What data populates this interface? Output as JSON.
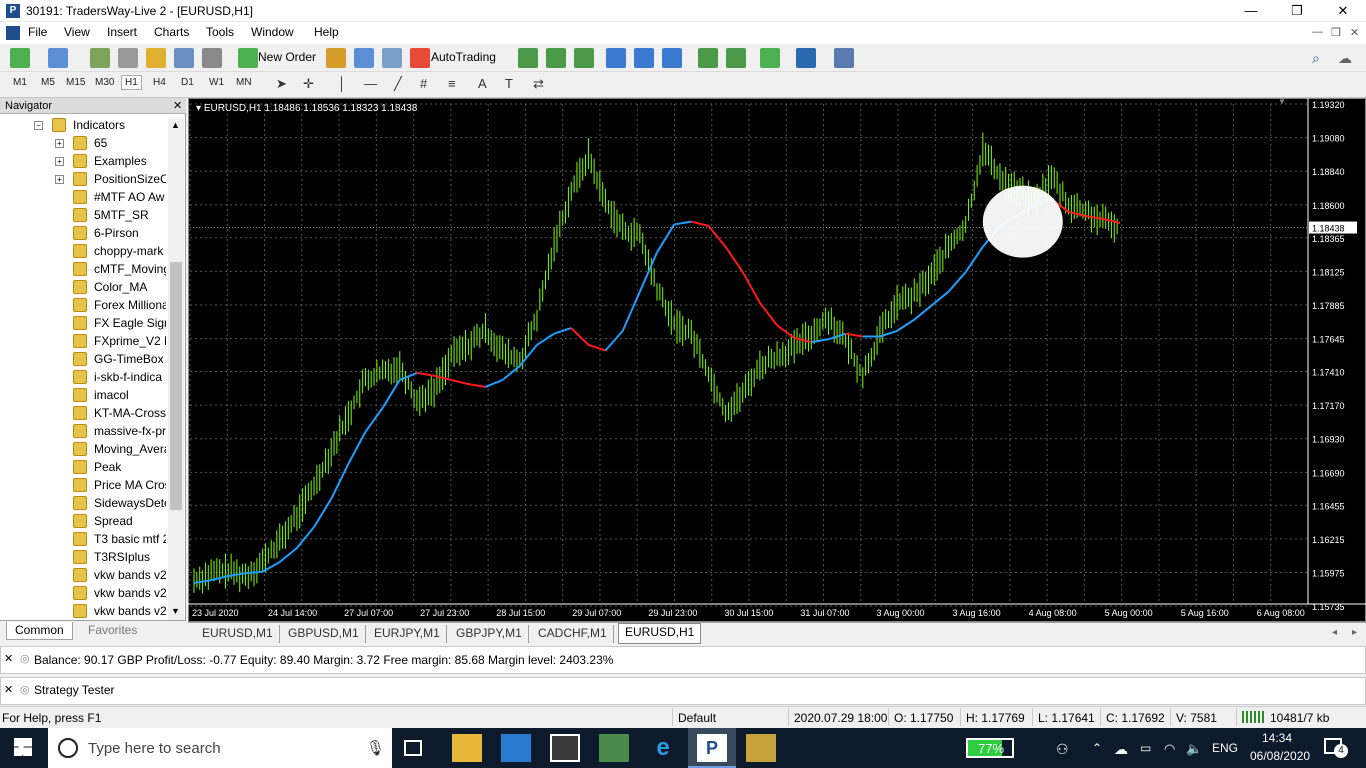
{
  "window": {
    "title": "30191: TradersWay-Live 2 - [EURUSD,H1]",
    "app_icon": "P",
    "minimize": "—",
    "maximize": "❐",
    "close": "✕"
  },
  "menu": [
    "File",
    "View",
    "Insert",
    "Charts",
    "Tools",
    "Window",
    "Help"
  ],
  "toolbar": {
    "new_order": "New Order",
    "auto_trading": "AutoTrading"
  },
  "timeframes": [
    "M1",
    "M5",
    "M15",
    "M30",
    "H1",
    "H4",
    "D1",
    "W1",
    "MN"
  ],
  "active_timeframe": "H1",
  "navigator": {
    "title": "Navigator",
    "root": "Indicators",
    "items": [
      "65",
      "Examples",
      "PositionSizeC",
      "#MTF AO Aw",
      "5MTF_SR",
      "6-Pirson",
      "choppy-mark",
      "cMTF_Moving",
      "Color_MA",
      "Forex Milliona",
      "FX Eagle Signa",
      "FXprime_V2 F",
      "GG-TimeBox",
      "i-skb-f-indica",
      "imacol",
      "KT-MA-Cross",
      "massive-fx-pr",
      "Moving_Avera",
      "Peak",
      "Price MA Cros",
      "SidewaysDete",
      "Spread",
      "T3 basic mtf 2",
      "T3RSIplus",
      "vkw bands v2",
      "vkw bands v2",
      "vkw bands v2"
    ],
    "tabs": [
      "Common",
      "Favorites"
    ]
  },
  "chart": {
    "header": "EURUSD,H1  1.18486 1.18536 1.18323 1.18438",
    "current_price": "1.18438",
    "colors": {
      "background": "#000000",
      "candles": "#7cfc00",
      "ma_up": "#1e9fff",
      "ma_down": "#ff1a1a",
      "grid": "#555555",
      "annotation": "#ffffff"
    }
  },
  "chart_data": {
    "type": "line",
    "symbol": "EURUSD",
    "timeframe": "H1",
    "title": "EURUSD,H1",
    "ylim": [
      1.1575,
      1.1932
    ],
    "y_ticks": [
      "1.19320",
      "1.19080",
      "1.18840",
      "1.18600",
      "1.18365",
      "1.18125",
      "1.17885",
      "1.17645",
      "1.17410",
      "1.17170",
      "1.16930",
      "1.16690",
      "1.16455",
      "1.16215",
      "1.15975",
      "1.15735"
    ],
    "x_ticks": [
      "23 Jul 2020",
      "24 Jul 14:00",
      "27 Jul 07:00",
      "27 Jul 23:00",
      "28 Jul 15:00",
      "29 Jul 07:00",
      "29 Jul 23:00",
      "30 Jul 15:00",
      "31 Jul 07:00",
      "3 Aug 00:00",
      "3 Aug 16:00",
      "4 Aug 08:00",
      "5 Aug 00:00",
      "5 Aug 16:00",
      "6 Aug 08:00"
    ],
    "series": [
      {
        "values": [
          1.1592,
          1.1597,
          1.1599,
          1.1595,
          1.1605,
          1.162,
          1.1638,
          1.166,
          1.1685,
          1.171,
          1.1735,
          1.174,
          1.1745,
          1.172,
          1.1728,
          1.1752,
          1.176,
          1.177,
          1.1755,
          1.1748,
          1.178,
          1.1832,
          1.187,
          1.1895,
          1.1862,
          1.1842,
          1.1838,
          1.18,
          1.1775,
          1.1768,
          1.174,
          1.1712,
          1.1725,
          1.1745,
          1.1752,
          1.1758,
          1.1768,
          1.178,
          1.1762,
          1.1738,
          1.1768,
          1.179,
          1.1795,
          1.181,
          1.183,
          1.1845,
          1.19,
          1.188,
          1.187,
          1.1862,
          1.188,
          1.186,
          1.1855,
          1.1848,
          1.1844
        ]
      },
      {
        "values": [
          1.159,
          1.1592,
          1.1595,
          1.1597,
          1.1598,
          1.1605,
          1.1615,
          1.163,
          1.165,
          1.1675,
          1.1698,
          1.1715,
          1.1735,
          1.174,
          1.1738,
          1.1735,
          1.1732,
          1.173,
          1.1735,
          1.1745,
          1.176,
          1.1768,
          1.1772,
          1.176,
          1.1756,
          1.177,
          1.1798,
          1.1826,
          1.1846,
          1.1848,
          1.1845,
          1.183,
          1.1812,
          1.179,
          1.1774,
          1.1765,
          1.1762,
          1.1764,
          1.1768,
          1.1766,
          1.1766,
          1.177,
          1.1778,
          1.1788,
          1.1798,
          1.1812,
          1.183,
          1.1845,
          1.1852,
          1.186,
          1.1864,
          1.1855,
          1.1852,
          1.185,
          1.1847
        ]
      }
    ]
  },
  "chart_tabs": [
    "EURUSD,M1",
    "GBPUSD,M1",
    "EURJPY,M1",
    "GBPJPY,M1",
    "CADCHF,M1",
    "EURUSD,H1"
  ],
  "active_chart_tab": "EURUSD,H1",
  "terminal": {
    "text": "Balance: 90.17 GBP  Profit/Loss: -0.77  Equity: 89.40  Margin: 3.72  Free margin: 85.68  Margin level: 2403.23%"
  },
  "tester": {
    "text": "Strategy Tester"
  },
  "statusbar": {
    "help": "For Help, press F1",
    "profile": "Default",
    "datetime": "2020.07.29 18:00",
    "open": "O: 1.17750",
    "high": "H: 1.17769",
    "low": "L: 1.17641",
    "close": "C: 1.17692",
    "volume": "V: 7581",
    "traffic": "10481/7 kb"
  },
  "taskbar": {
    "search_placeholder": "Type here to search",
    "battery": "77%",
    "lang": "ENG",
    "time": "14:34",
    "date": "06/08/2020",
    "notifications": "4"
  }
}
